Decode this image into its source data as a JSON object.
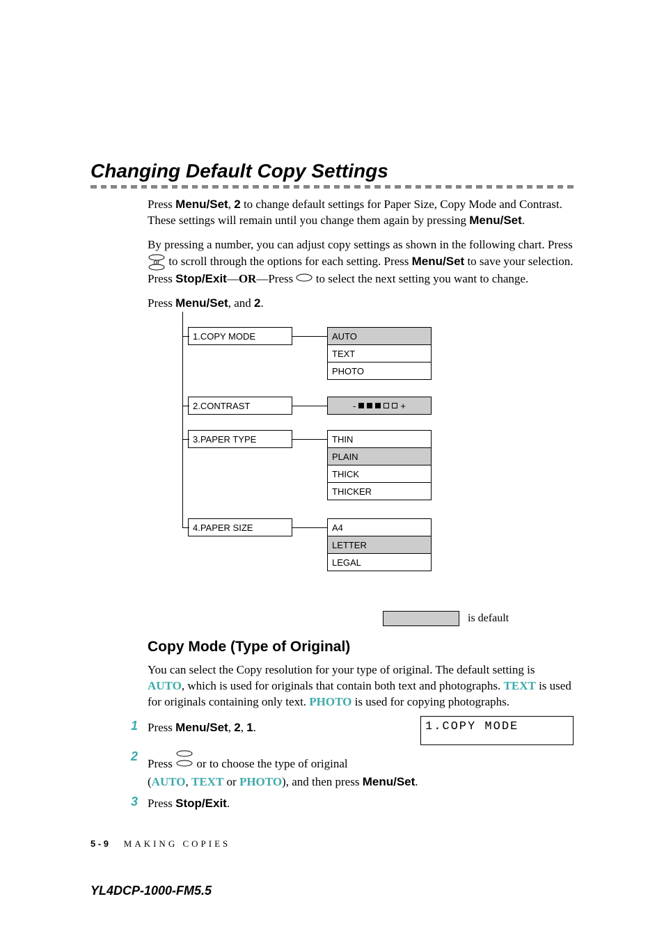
{
  "heading": "Changing Default Copy Settings",
  "para1_a": "Press ",
  "para1_bold1": "Menu/Set",
  "para1_b": ", ",
  "para1_bold2": "2",
  "para1_c": " to change default settings for Paper Size, Copy Mode and Contrast. These settings will remain until you change them again by pressing ",
  "para1_bold3": "Menu/Set",
  "para1_d": ".",
  "para2_a": "By pressing a number, you can adjust copy settings as shown in the following chart. Press ",
  "para2_or": "or",
  "para2_b": " to scroll through the options for each setting. Press ",
  "para2_bold1": "Menu/Set",
  "para2_c": " to save your selection. Press ",
  "para2_bold2": "Stop/Exit",
  "para2_d": "—",
  "para2_bold3": "OR",
  "para2_e": "—Press ",
  "para2_f": " to select the next setting you want to change.",
  "para3_a": "Press ",
  "para3_bold1": "Menu/Set",
  "para3_b": ", and ",
  "para3_bold2": "2",
  "para3_c": ".",
  "menu": {
    "row1": {
      "label": "1.COPY MODE",
      "opts": [
        "AUTO",
        "TEXT",
        "PHOTO"
      ],
      "default_index": 0
    },
    "row2": {
      "label": "2.CONTRAST"
    },
    "row3": {
      "label": "3.PAPER TYPE",
      "opts": [
        "THIN",
        "PLAIN",
        "THICK",
        "THICKER"
      ],
      "default_index": 1
    },
    "row4": {
      "label": "4.PAPER SIZE",
      "opts": [
        "A4",
        "LETTER",
        "LEGAL"
      ],
      "default_index": 1
    }
  },
  "default_legend": "is default",
  "subheading": "Copy Mode (Type of Original)",
  "sub_para_a": "You can select the Copy resolution for your type of original. The default setting is ",
  "sub_teal1": "AUTO",
  "sub_para_b": ", which is used for originals that contain both text and photographs. ",
  "sub_teal2": "TEXT",
  "sub_para_c": " is used for originals containing only text. ",
  "sub_teal3": "PHOTO",
  "sub_para_d": " is used for copying photographs.",
  "steps": {
    "s1_a": "Press ",
    "s1_bold1": "Menu/Set",
    "s1_b": ", ",
    "s1_bold2": "2",
    "s1_c": ", ",
    "s1_bold3": "1",
    "s1_d": ".",
    "lcd": "1.COPY MODE",
    "s2_a": "Press ",
    "s2_or": "or",
    "s2_b": " to choose the type of original",
    "s2_c": "(",
    "s2_teal1": "AUTO",
    "s2_d": ", ",
    "s2_teal2": "TEXT",
    "s2_e": " or ",
    "s2_teal3": "PHOTO",
    "s2_f": "), and then press ",
    "s2_bold1": "Menu/Set",
    "s2_g": ".",
    "s3_a": "Press ",
    "s3_bold1": "Stop/Exit",
    "s3_b": "."
  },
  "footer_page": "5 - 9",
  "footer_title": "MAKING COPIES",
  "watermark": "YL4DCP-1000-FM5.5"
}
